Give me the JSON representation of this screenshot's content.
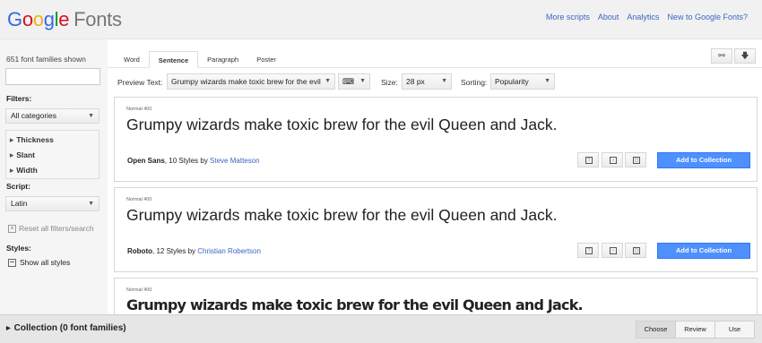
{
  "header": {
    "logo_letters": [
      {
        "ch": "G",
        "color": "#3369e8"
      },
      {
        "ch": "o",
        "color": "#d50f25"
      },
      {
        "ch": "o",
        "color": "#eeb211"
      },
      {
        "ch": "g",
        "color": "#3369e8"
      },
      {
        "ch": "l",
        "color": "#009925"
      },
      {
        "ch": "e",
        "color": "#d50f25"
      }
    ],
    "logo_suffix": "Fonts",
    "links": [
      "More scripts",
      "About",
      "Analytics",
      "New to Google Fonts?"
    ]
  },
  "sidebar": {
    "families_count": "651 font families shown",
    "search_value": "",
    "filters_heading": "Filters:",
    "category_select": "All categories",
    "filter_items": [
      "Thickness",
      "Slant",
      "Width"
    ],
    "script_heading": "Script:",
    "script_select": "Latin",
    "reset_label": "Reset all filters/search",
    "styles_heading": "Styles:",
    "show_all_label": "Show all styles"
  },
  "main": {
    "tabs": [
      {
        "label": "Word",
        "active": false
      },
      {
        "label": "Sentence",
        "active": true
      },
      {
        "label": "Paragraph",
        "active": false
      },
      {
        "label": "Poster",
        "active": false
      }
    ],
    "toolbar": {
      "preview_label": "Preview Text:",
      "preview_value": "Grumpy wizards make toxic brew for the evil",
      "size_label": "Size:",
      "size_value": "28 px",
      "sorting_label": "Sorting:",
      "sorting_value": "Popularity"
    },
    "cards": [
      {
        "style": "Normal 400",
        "sample": "Grumpy wizards make toxic brew for the evil Queen and Jack.",
        "family": "Open Sans",
        "styles": ", 10 Styles by ",
        "author": "Steve Matteson",
        "add_label": "Add to Collection"
      },
      {
        "style": "Normal 400",
        "sample": "Grumpy wizards make toxic brew for the evil Queen and Jack.",
        "family": "Roboto",
        "styles": ", 12 Styles by ",
        "author": "Christian Robertson",
        "add_label": "Add to Collection"
      },
      {
        "style": "Normal 400",
        "sample": "Grumpy wizards make toxic brew for the evil Queen and Jack."
      }
    ]
  },
  "footer": {
    "collection_label": "Collection (0 font families)",
    "steps": [
      {
        "label": "Choose",
        "active": true
      },
      {
        "label": "Review",
        "active": false
      },
      {
        "label": "Use",
        "active": false
      }
    ]
  }
}
